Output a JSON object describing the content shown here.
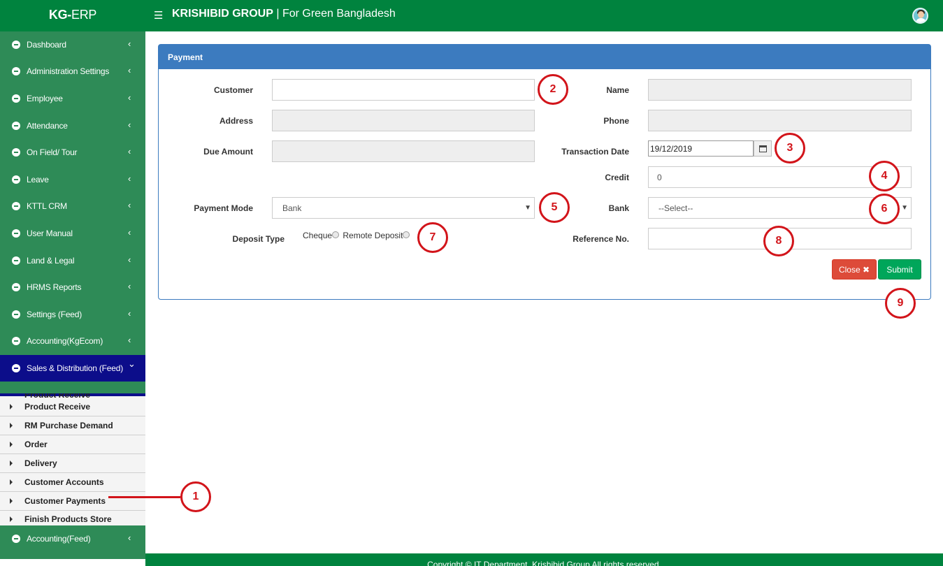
{
  "header": {
    "brand_bold": "KG-",
    "brand_rest": "ERP",
    "company_bold": "KRISHIBID GROUP",
    "company_rest": " | For Green Bangladesh",
    "menu_icon": "hamburger-icon",
    "avatar_icon": "user-avatar-icon"
  },
  "sidebar": {
    "items": [
      {
        "label": "Dashboard"
      },
      {
        "label": "Administration Settings"
      },
      {
        "label": "Employee"
      },
      {
        "label": "Attendance"
      },
      {
        "label": "On Field/ Tour"
      },
      {
        "label": "Leave"
      },
      {
        "label": "KTTL CRM"
      },
      {
        "label": "User Manual"
      },
      {
        "label": "Land & Legal"
      },
      {
        "label": "HRMS Reports"
      },
      {
        "label": "Settings (Feed)"
      },
      {
        "label": "Accounting(KgEcom)"
      },
      {
        "label": "Sales & Distribution (Feed)"
      }
    ],
    "cut_item": "Product Receive",
    "subitems": [
      {
        "label": "Product Receive"
      },
      {
        "label": "RM Purchase Demand"
      },
      {
        "label": "Order"
      },
      {
        "label": "Delivery"
      },
      {
        "label": "Customer Accounts"
      },
      {
        "label": "Customer Payments"
      },
      {
        "label": "Finish Products Store"
      }
    ],
    "last_item": {
      "label": "Accounting(Feed)"
    },
    "chevron_left": "‹",
    "chevron_down": "⌄"
  },
  "panel": {
    "title": "Payment",
    "labels": {
      "customer": "Customer",
      "address": "Address",
      "due_amount": "Due Amount",
      "payment_mode": "Payment Mode",
      "deposit_type": "Deposit Type",
      "name": "Name",
      "phone": "Phone",
      "transaction_date": "Transaction Date",
      "credit": "Credit",
      "bank": "Bank",
      "reference_no": "Reference No."
    },
    "values": {
      "customer": "",
      "address": "",
      "due_amount": "",
      "name": "",
      "phone": "",
      "transaction_date": "19/12/2019",
      "credit": "0",
      "payment_mode": "Bank",
      "bank": "--Select--",
      "reference_no": ""
    },
    "radios": {
      "cheque": "Cheque",
      "remote_deposit": "Remote Deposit"
    },
    "buttons": {
      "close": "Close",
      "close_icon": "✖",
      "submit": "Submit"
    }
  },
  "annotations": [
    "1",
    "2",
    "3",
    "4",
    "5",
    "6",
    "7",
    "8",
    "9"
  ],
  "footer": {
    "text": "Copyright © IT Department, Krishibid Group All rights reserved."
  },
  "colors": {
    "topbar": "#00833e",
    "sidebar": "#2e8b57",
    "active_menu": "#0c0d8a",
    "panel_header": "#3c7bbf",
    "close_button": "#dd4b39",
    "submit_button": "#00a65a",
    "annotation": "#d2141a"
  }
}
